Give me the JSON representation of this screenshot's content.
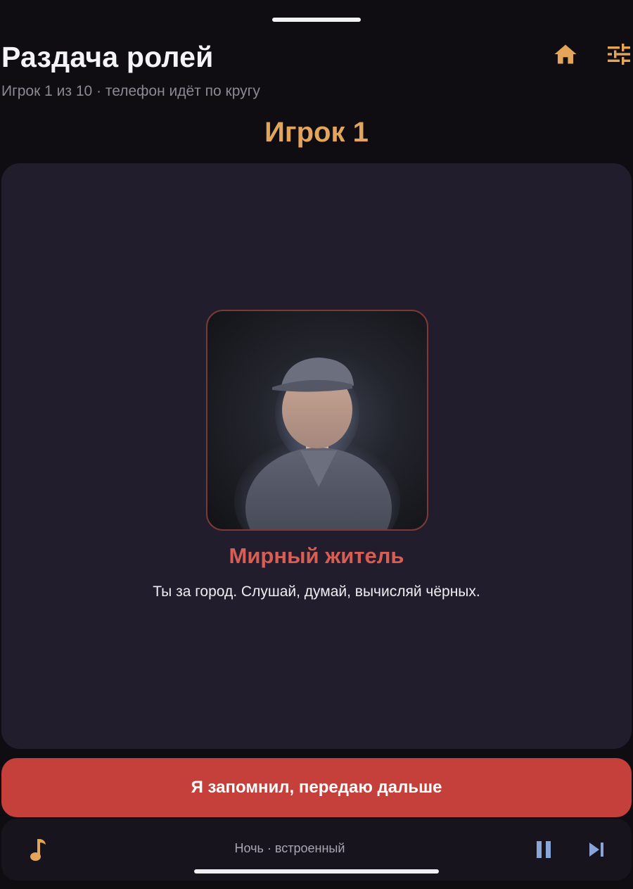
{
  "header": {
    "title": "Раздача ролей",
    "subtitle": "Игрок 1 из 10 · телефон идёт по кругу",
    "home_icon": "home-icon",
    "settings_icon": "tune-sliders-icon"
  },
  "player": {
    "heading": "Игрок 1"
  },
  "role": {
    "name": "Мирный житель",
    "description": "Ты за город. Слушай, думай, вычисляй чёрных.",
    "illustration": "civilian-portrait"
  },
  "actions": {
    "confirm_label": "Я запомнил, передаю дальше"
  },
  "music": {
    "track_label": "Ночь · встроенный",
    "note_icon": "music-note-icon",
    "pause_icon": "pause-icon",
    "next_icon": "skip-next-icon"
  },
  "colors": {
    "accent_gold": "#e2a55a",
    "role_red": "#d85e54",
    "button_red": "#c5403b",
    "card_bg": "#221d2d",
    "page_bg": "#0f0d12",
    "media_blue": "#8aa6d8"
  }
}
